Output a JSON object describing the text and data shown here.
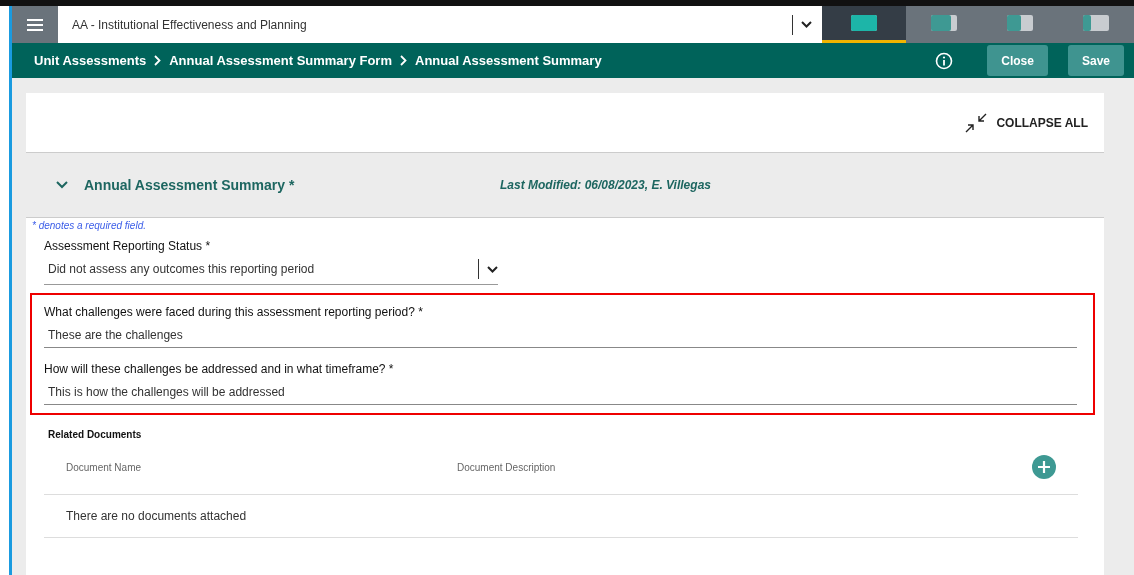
{
  "top_bar": {
    "unit_select": {
      "value": "AA - Institutional Effectiveness and Planning"
    },
    "layout_tabs": [
      {
        "kind": "full",
        "selected": true
      },
      {
        "kind": "wide",
        "selected": false
      },
      {
        "kind": "half",
        "selected": false
      },
      {
        "kind": "narrow",
        "selected": false
      }
    ]
  },
  "breadcrumb": [
    "Unit Assessments",
    "Annual Assessment Summary Form",
    "Annual Assessment Summary"
  ],
  "actions": {
    "buttons": [
      "Close",
      "Save"
    ]
  },
  "collapse_all": "COLLAPSE ALL",
  "section": {
    "title": "Annual Assessment Summary *",
    "expanded": true,
    "last_modified": "Last Modified: 06/08/2023, E. Villegas"
  },
  "required_note": "* denotes a required field.",
  "status_field": {
    "label": "Assessment Reporting Status *",
    "value": "Did not assess any outcomes this reporting period"
  },
  "highlighted_fields": [
    {
      "label": "What challenges were faced during this assessment reporting period? *",
      "value": "These are the challenges"
    },
    {
      "label": "How will these challenges be addressed and in what timeframe? *",
      "value": "This is how the challenges will be addressed"
    }
  ],
  "related_documents": {
    "title": "Related Documents",
    "columns": [
      "Document Name",
      "Document Description"
    ],
    "empty_text": "There are no documents attached"
  }
}
